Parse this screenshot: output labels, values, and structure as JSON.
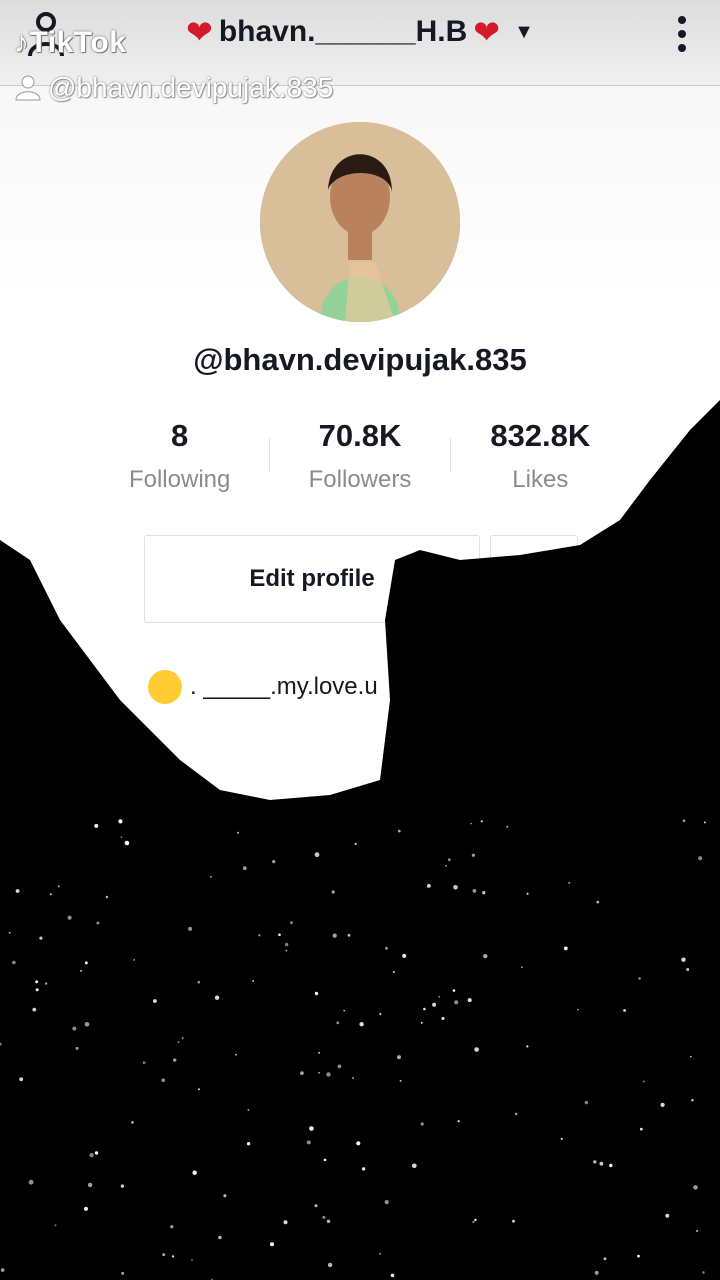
{
  "header": {
    "title": "bhavn.______H.B",
    "menu_icon": "more-vertical-icon",
    "add_user_icon": "add-user-icon",
    "dropdown_icon": "caret-down-icon"
  },
  "watermark": {
    "logo_text": "TikTok",
    "handle": "@bhavn.devipujak.835"
  },
  "profile": {
    "username": "@bhavn.devipujak.835",
    "stats": [
      {
        "value": "8",
        "label": "Following"
      },
      {
        "value": "70.8K",
        "label": "Followers"
      },
      {
        "value": "832.8K",
        "label": "Likes"
      }
    ],
    "edit_button": "Edit profile",
    "bio": ". _____.my.love.u"
  },
  "colors": {
    "text_primary": "#161823",
    "text_secondary": "#8a8b91",
    "heart": "#d3192b",
    "overlay": "#000000"
  }
}
